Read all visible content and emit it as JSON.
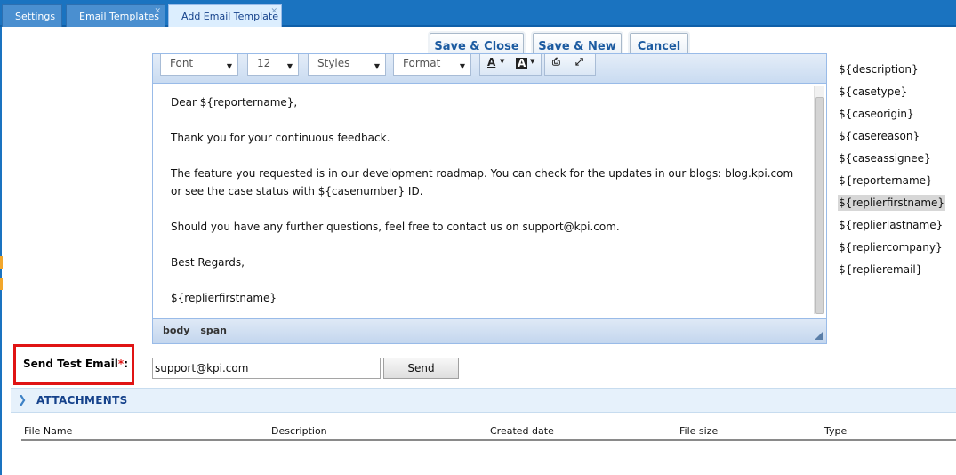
{
  "tabs": [
    {
      "label": "Settings",
      "active": false
    },
    {
      "label": "Email Templates",
      "active": false,
      "closable": true
    },
    {
      "label": "Add Email Template",
      "active": true,
      "closable": true
    }
  ],
  "actions": {
    "save_close": "Save & Close",
    "save_new": "Save & New",
    "cancel": "Cancel"
  },
  "editor": {
    "toolbar": {
      "font": "Font",
      "size": "12",
      "styles": "Styles",
      "format": "Format",
      "text_color_glyph": "A",
      "bg_color_glyph": "A"
    },
    "body": [
      "Dear ${reportername},",
      "Thank you for your continuous feedback.",
      "The feature you requested is in our development roadmap. You can check for the updates in our blogs: blog.kpi.com",
      "or see the case status with ${casenumber} ID.",
      "Should you have any further questions, feel free to contact us on support@kpi.com.",
      "Best Regards,",
      "${replierfirstname}"
    ],
    "path": [
      "body",
      "span"
    ]
  },
  "placeholders": [
    {
      "text": "${description}",
      "selected": false
    },
    {
      "text": "${casetype}",
      "selected": false
    },
    {
      "text": "${caseorigin}",
      "selected": false
    },
    {
      "text": "${casereason}",
      "selected": false
    },
    {
      "text": "${caseassignee}",
      "selected": false
    },
    {
      "text": "${reportername}",
      "selected": false
    },
    {
      "text": "${replierfirstname}",
      "selected": true
    },
    {
      "text": "${replierlastname}",
      "selected": false
    },
    {
      "text": "${repliercompany}",
      "selected": false
    },
    {
      "text": "${replieremail}",
      "selected": false
    }
  ],
  "test_email": {
    "label": "Send Test Email",
    "required_mark": "*",
    "label_suffix": ":",
    "value": "support@kpi.com",
    "send_label": "Send"
  },
  "attachments": {
    "title": "ATTACHMENTS",
    "columns": [
      "File Name",
      "Description",
      "Created date",
      "File size",
      "Type"
    ]
  },
  "colors": {
    "tabbar": "#1a73c0",
    "accent_blue": "#15428b",
    "required_red": "#e01414"
  }
}
